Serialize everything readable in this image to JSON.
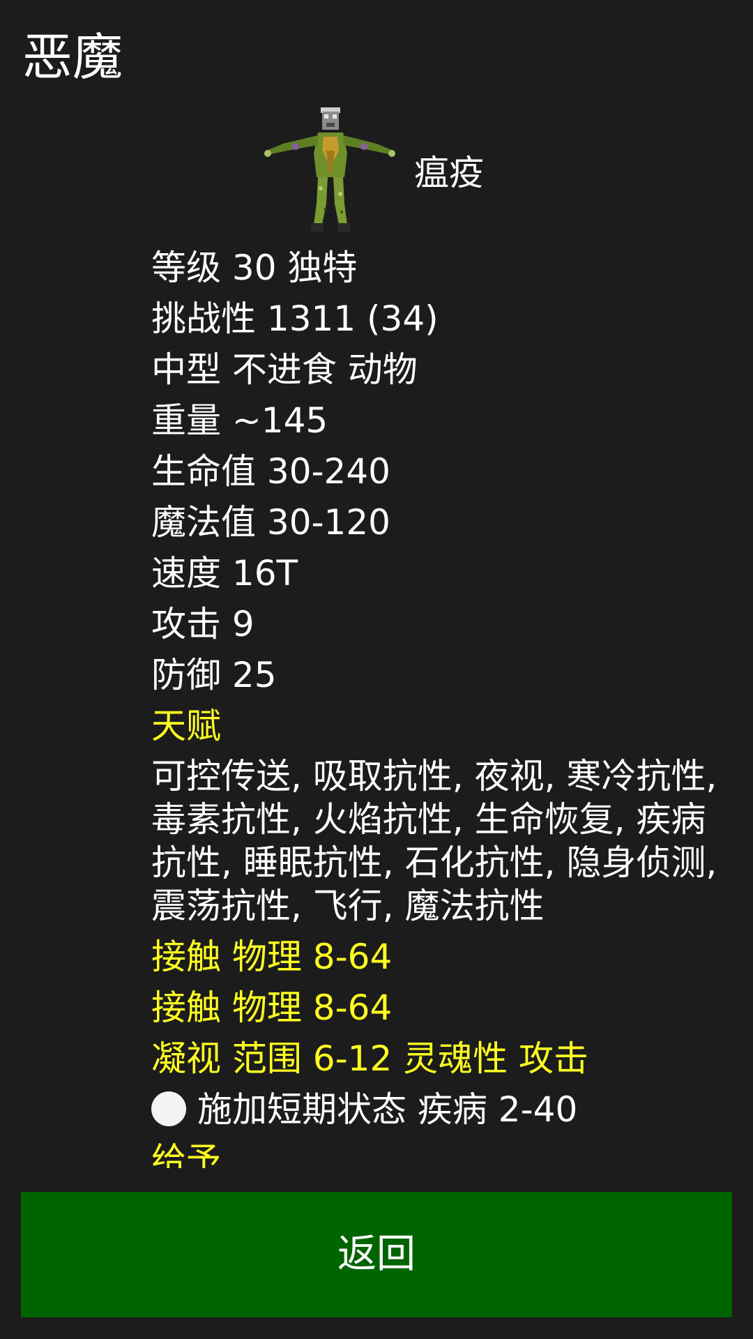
{
  "header": {
    "title": "恶魔"
  },
  "monster": {
    "name": "瘟疫",
    "sprite_icon": "plague-demon-sprite"
  },
  "stats": {
    "level": "等级 30 独特",
    "challenge": "挑战性 1311 (34)",
    "type": "中型 不进食 动物",
    "weight": "重量 ~145",
    "hp": "生命值 30-240",
    "mp": "魔法值 30-120",
    "speed": "速度 16T",
    "attack": "攻击 9",
    "defense": "防御 25",
    "talents_heading": "天赋",
    "talents": "可控传送, 吸取抗性, 夜视, 寒冷抗性, 毒素抗性, 火焰抗性, 生命恢复, 疾病抗性, 睡眠抗性, 石化抗性, 隐身侦测, 震荡抗性, 飞行, 魔法抗性",
    "attacks": [
      "接触 物理 8-64",
      "接触 物理 8-64",
      "凝视 范围 6-12 灵魂性 攻击"
    ],
    "effect": "施加短期状态 疾病 2-40",
    "grants_heading": "给予"
  },
  "footer": {
    "back_label": "返回"
  },
  "colors": {
    "background": "#1c1c1c",
    "text": "#ffffff",
    "highlight": "#ffff21",
    "button": "#006400"
  }
}
